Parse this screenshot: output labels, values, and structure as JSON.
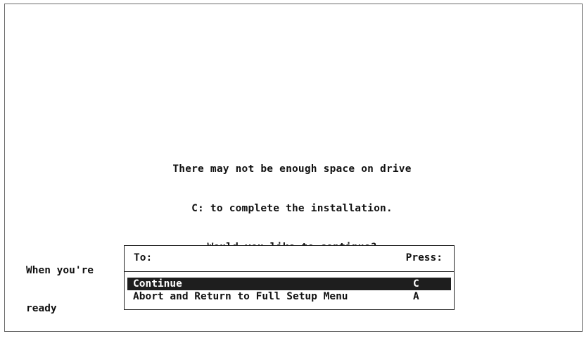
{
  "message": {
    "line1": "There may not be enough space on drive",
    "line2": "C: to complete the installation.",
    "line3": "Would you like to continue?"
  },
  "prompt": {
    "line1": "When you're",
    "line2": "ready"
  },
  "options_box": {
    "header_to": "To:",
    "header_press": "Press:",
    "items": [
      {
        "label": "Continue",
        "key": "C",
        "selected": true
      },
      {
        "label": "Abort and Return to Full Setup Menu",
        "key": "A",
        "selected": false
      }
    ]
  },
  "colors": {
    "background": "#ffffff",
    "text": "#111111",
    "highlight": "#1e1e1e",
    "highlight_text": "#ffffff"
  }
}
